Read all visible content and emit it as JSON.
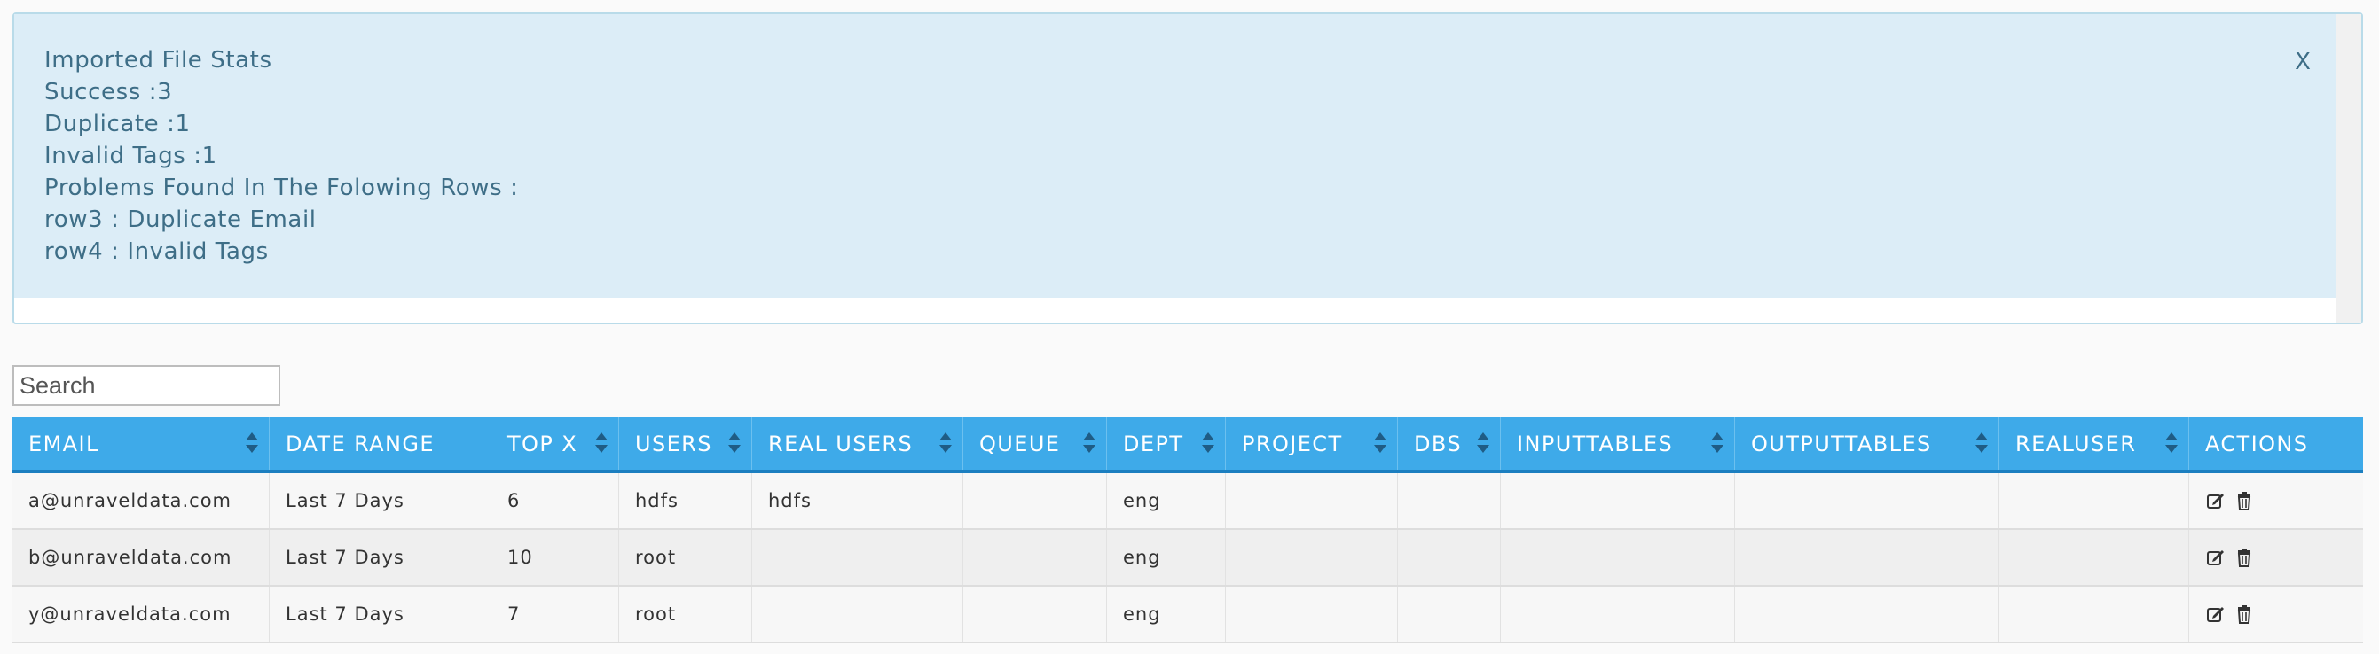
{
  "import_stats": {
    "lines": [
      "Imported File Stats",
      "Success :3",
      "Duplicate :1",
      "Invalid Tags :1",
      "Problems Found In The Folowing Rows :",
      "row3 : Duplicate Email",
      "row4 : Invalid Tags"
    ],
    "close_label": "X"
  },
  "search": {
    "placeholder": "Search",
    "value": ""
  },
  "table": {
    "columns": [
      {
        "label": "EMAIL",
        "sortable": true
      },
      {
        "label": "DATE RANGE",
        "sortable": false
      },
      {
        "label": "TOP X",
        "sortable": true
      },
      {
        "label": "USERS",
        "sortable": true
      },
      {
        "label": "REAL USERS",
        "sortable": true
      },
      {
        "label": "QUEUE",
        "sortable": true
      },
      {
        "label": "DEPT",
        "sortable": true
      },
      {
        "label": "PROJECT",
        "sortable": true
      },
      {
        "label": "DBS",
        "sortable": true
      },
      {
        "label": "INPUTTABLES",
        "sortable": true
      },
      {
        "label": "OUTPUTTABLES",
        "sortable": true
      },
      {
        "label": "REALUSER",
        "sortable": true
      },
      {
        "label": "ACTIONS",
        "sortable": false
      }
    ],
    "rows": [
      [
        "a@unraveldata.com",
        "Last 7 Days",
        "6",
        "hdfs",
        "hdfs",
        "",
        "eng",
        "",
        "",
        "",
        "",
        ""
      ],
      [
        "b@unraveldata.com",
        "Last 7 Days",
        "10",
        "root",
        "",
        "",
        "eng",
        "",
        "",
        "",
        "",
        ""
      ],
      [
        "y@unraveldata.com",
        "Last 7 Days",
        "7",
        "root",
        "",
        "",
        "eng",
        "",
        "",
        "",
        "",
        ""
      ]
    ],
    "row_actions": {
      "edit_icon": "edit-icon",
      "delete_icon": "trash-icon"
    }
  },
  "colors": {
    "alert_bg": "#dcedf7",
    "alert_text": "#3e6e87",
    "header_bg": "#3eaae9",
    "header_border": "#1c7fc0",
    "sort_arrow": "#1f5c85"
  }
}
